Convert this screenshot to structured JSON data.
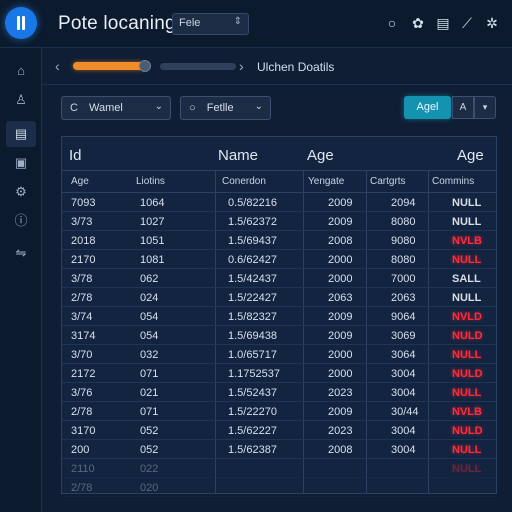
{
  "header": {
    "title": "Pote locaning:",
    "file_select": "Fe‌le",
    "icons": [
      "record-icon",
      "palette-icon",
      "document-icon",
      "edit-icon",
      "settings-icon"
    ]
  },
  "sidebar": {
    "items": [
      {
        "icon": "home-icon",
        "glyph": "⌂"
      },
      {
        "icon": "user-icon",
        "glyph": "♙"
      },
      {
        "icon": "document-icon",
        "glyph": "▤",
        "active": true
      },
      {
        "icon": "database-icon",
        "glyph": "▣"
      },
      {
        "icon": "settings-icon",
        "glyph": "⚙"
      },
      {
        "icon": "info-icon",
        "glyph": "ⓘ"
      },
      {
        "icon": "translate-icon",
        "glyph": "⇋"
      }
    ]
  },
  "progress": {
    "value_fraction": 0.92,
    "label": "Ulchen Doatils"
  },
  "filters": {
    "name_filter": {
      "icon": "C",
      "label": "Wamel"
    },
    "title_filter": {
      "icon": "○",
      "label": "Fetlle"
    },
    "age_button": "Agel",
    "a_button": "A",
    "dropdown_glyph": "▾"
  },
  "table": {
    "big_headers": [
      "Id",
      "Name",
      "Age",
      "Age"
    ],
    "columns": [
      "Age",
      "Liotins",
      "Conerdon",
      "Yengate",
      "Cartgrts",
      "Commins"
    ],
    "rows": [
      {
        "c": [
          "7093",
          "1064",
          "0.5/82216",
          "2009",
          "2094",
          "NULL"
        ],
        "red": false
      },
      {
        "c": [
          "3/73",
          "1027",
          "1.5/62372",
          "2009",
          "8080",
          "NULL"
        ],
        "red": false
      },
      {
        "c": [
          "2018",
          "1051",
          "1.5/69437",
          "2008",
          "9080",
          "NVLB"
        ],
        "red": true
      },
      {
        "c": [
          "2170",
          "1081",
          "0.6/62427",
          "2000",
          "8080",
          "NULL"
        ],
        "red": true
      },
      {
        "c": [
          "3/78",
          "062",
          "1.5/42437",
          "2000",
          "7000",
          "SALL"
        ],
        "red": false
      },
      {
        "c": [
          "2/78",
          "024",
          "1.5/22427",
          "2063",
          "2063",
          "NULL"
        ],
        "red": false
      },
      {
        "c": [
          "3/74",
          "054",
          "1.5/82327",
          "2009",
          "9064",
          "NVLD"
        ],
        "red": true
      },
      {
        "c": [
          "3174",
          "054",
          "1.5/69438",
          "2009",
          "3069",
          "NULD"
        ],
        "red": true
      },
      {
        "c": [
          "3/70",
          "032",
          "1.0/65717",
          "2000",
          "3064",
          "NULL"
        ],
        "red": true
      },
      {
        "c": [
          "2172",
          "071",
          "1.1752537",
          "2000",
          "3004",
          "NULD"
        ],
        "red": true
      },
      {
        "c": [
          "3/76",
          "021",
          "1.5/52437",
          "2023",
          "3004",
          "NULL"
        ],
        "red": true
      },
      {
        "c": [
          "2/78",
          "071",
          "1.5/22270",
          "2009",
          "30/44",
          "NVLB"
        ],
        "red": true
      },
      {
        "c": [
          "3170",
          "052",
          "1.5/62227",
          "2023",
          "3004",
          "NULD"
        ],
        "red": true
      },
      {
        "c": [
          "200",
          "052",
          "1.5/62387",
          "2008",
          "3004",
          "NULL"
        ],
        "red": true
      },
      {
        "c": [
          "2110",
          "022",
          "",
          "",
          "",
          "NULL"
        ],
        "red": true,
        "ghost": true
      },
      {
        "c": [
          "2/78",
          "020",
          "",
          "",
          "",
          ""
        ],
        "red": false,
        "ghost": true
      }
    ]
  },
  "colors": {
    "accent": "#1a78e6",
    "progress": "#f08c2a",
    "teal_button": "#1592b0",
    "null_red": "#ff2d3a"
  }
}
